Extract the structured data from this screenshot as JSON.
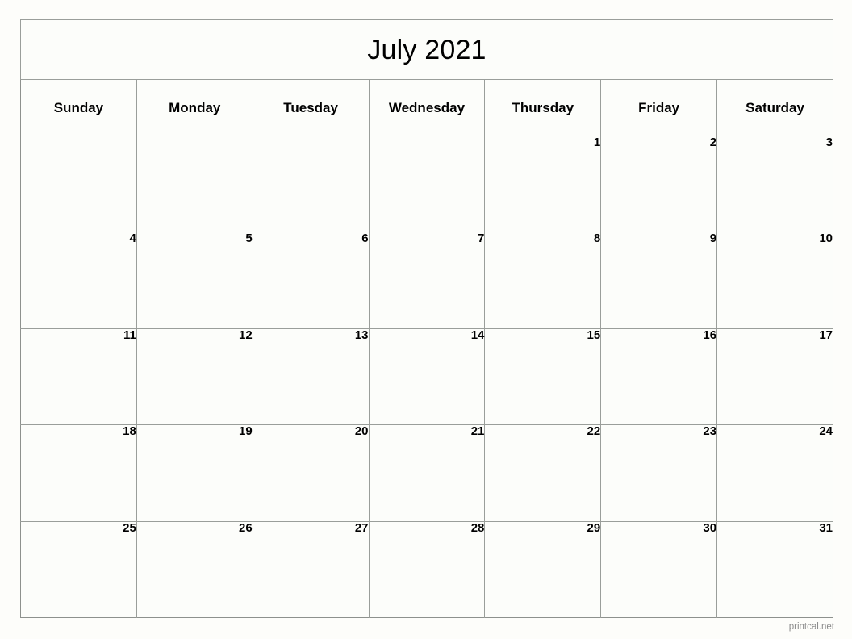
{
  "calendar": {
    "title": "July 2021",
    "month": "July",
    "year": "2021",
    "weekdays": [
      "Sunday",
      "Monday",
      "Tuesday",
      "Wednesday",
      "Thursday",
      "Friday",
      "Saturday"
    ],
    "weeks": [
      [
        "",
        "",
        "",
        "",
        "1",
        "2",
        "3"
      ],
      [
        "4",
        "5",
        "6",
        "7",
        "8",
        "9",
        "10"
      ],
      [
        "11",
        "12",
        "13",
        "14",
        "15",
        "16",
        "17"
      ],
      [
        "18",
        "19",
        "20",
        "21",
        "22",
        "23",
        "24"
      ],
      [
        "25",
        "26",
        "27",
        "28",
        "29",
        "30",
        "31"
      ]
    ],
    "colors": {
      "grid": "#9a9e9a",
      "border": "#8d918d",
      "text": "#000000",
      "background": "#fcfdfa",
      "footer_text": "#8c8c8c"
    }
  },
  "footer": {
    "watermark": "printcal.net"
  }
}
